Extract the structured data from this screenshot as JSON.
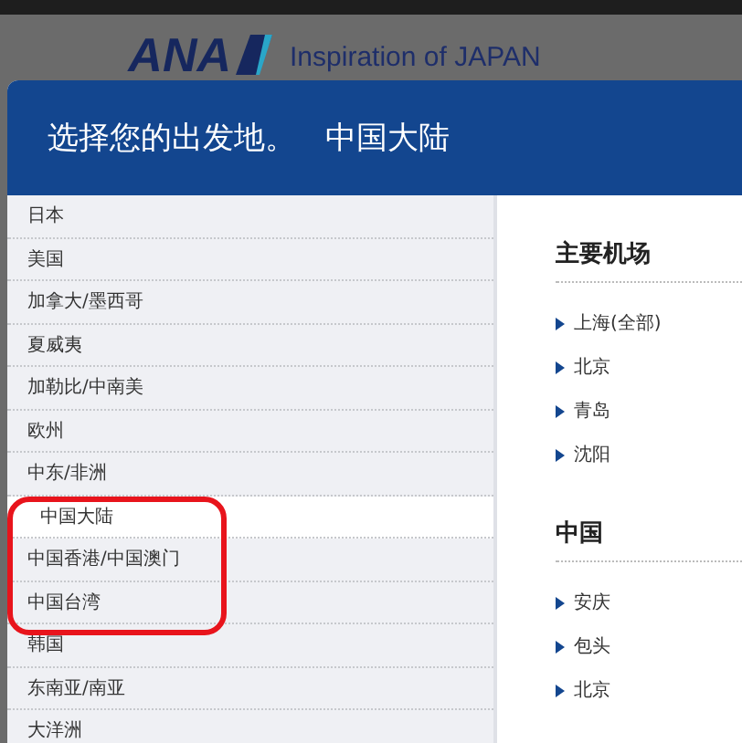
{
  "header": {
    "logo": "ANA",
    "tagline": "Inspiration of JAPAN"
  },
  "dialog": {
    "title": "选择您的出发地。",
    "current": "中国大陆"
  },
  "regions": [
    {
      "label": "日本",
      "selected": false
    },
    {
      "label": "美国",
      "selected": false
    },
    {
      "label": "加拿大/墨西哥",
      "selected": false
    },
    {
      "label": "夏威夷",
      "selected": false
    },
    {
      "label": "加勒比/中南美",
      "selected": false
    },
    {
      "label": "欧州",
      "selected": false
    },
    {
      "label": "中东/非洲",
      "selected": false
    },
    {
      "label": "中国大陆",
      "selected": true
    },
    {
      "label": "中国香港/中国澳门",
      "selected": false
    },
    {
      "label": "中国台湾",
      "selected": false
    },
    {
      "label": "韩国",
      "selected": false
    },
    {
      "label": "东南亚/南亚",
      "selected": false
    },
    {
      "label": "大洋洲",
      "selected": false
    }
  ],
  "airport_groups": [
    {
      "heading": "主要机场",
      "cities": [
        "上海(全部)",
        "北京",
        "青岛",
        "沈阳"
      ]
    },
    {
      "heading": "中国",
      "cities": [
        "安庆",
        "包头",
        "北京"
      ]
    }
  ]
}
